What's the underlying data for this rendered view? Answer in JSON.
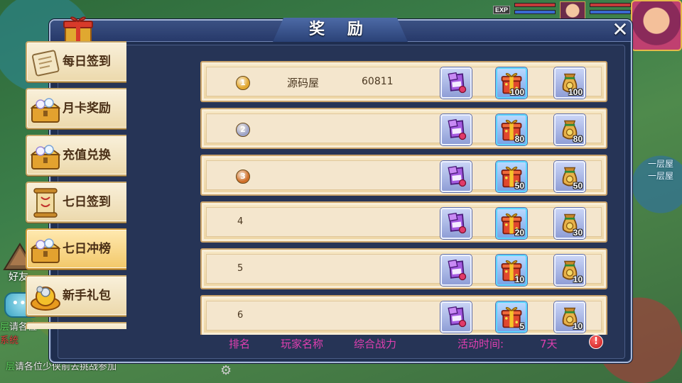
{
  "dialog": {
    "title": "奖  励",
    "close_symbol": "✕"
  },
  "hud": {
    "exp_label": "EXP"
  },
  "background": {
    "right_text": "一层屋\n一层屋",
    "friend_label": "好友",
    "chat_lines": [
      {
        "tag": "层",
        "text": "请各位"
      },
      {
        "tag": "系统",
        "text": ""
      }
    ],
    "bottom_chat": {
      "tag": "层",
      "text": "请各位少侠前去挑战参加"
    }
  },
  "nav": {
    "items": [
      {
        "label": "每日签到",
        "icon": "paper-scroll-icon",
        "active": false
      },
      {
        "label": "月卡奖励",
        "icon": "treasure-chest-icon",
        "active": false
      },
      {
        "label": "充值兑换",
        "icon": "treasure-chest-icon",
        "active": false
      },
      {
        "label": "七日签到",
        "icon": "scroll-icon",
        "active": false
      },
      {
        "label": "七日冲榜",
        "icon": "treasure-chest-icon",
        "active": true
      },
      {
        "label": "新手礼包",
        "icon": "gold-ingot-icon",
        "active": false
      }
    ]
  },
  "rows": [
    {
      "rank": "1",
      "medal": "gold",
      "name": "源码屋",
      "power": "60811",
      "rewards": [
        {
          "icon": "purple-scroll-icon",
          "qty": ""
        },
        {
          "icon": "gift-box-icon",
          "qty": "100"
        },
        {
          "icon": "money-bag-icon",
          "qty": "100"
        }
      ]
    },
    {
      "rank": "2",
      "medal": "silver",
      "name": "",
      "power": "",
      "rewards": [
        {
          "icon": "purple-scroll-icon",
          "qty": ""
        },
        {
          "icon": "gift-box-icon",
          "qty": "80"
        },
        {
          "icon": "money-bag-icon",
          "qty": "80"
        }
      ]
    },
    {
      "rank": "3",
      "medal": "bronze",
      "name": "",
      "power": "",
      "rewards": [
        {
          "icon": "purple-scroll-icon",
          "qty": ""
        },
        {
          "icon": "gift-box-icon",
          "qty": "50"
        },
        {
          "icon": "money-bag-icon",
          "qty": "50"
        }
      ]
    },
    {
      "rank": "4",
      "medal": "",
      "name": "",
      "power": "",
      "rewards": [
        {
          "icon": "purple-scroll-icon",
          "qty": ""
        },
        {
          "icon": "gift-box-icon",
          "qty": "20"
        },
        {
          "icon": "money-bag-icon",
          "qty": "30"
        }
      ]
    },
    {
      "rank": "5",
      "medal": "",
      "name": "",
      "power": "",
      "rewards": [
        {
          "icon": "purple-scroll-icon",
          "qty": ""
        },
        {
          "icon": "gift-box-icon",
          "qty": "10"
        },
        {
          "icon": "money-bag-icon",
          "qty": "10"
        }
      ]
    },
    {
      "rank": "6",
      "medal": "",
      "name": "",
      "power": "",
      "rewards": [
        {
          "icon": "purple-scroll-icon",
          "qty": ""
        },
        {
          "icon": "gift-box-icon",
          "qty": "5"
        },
        {
          "icon": "money-bag-icon",
          "qty": "10"
        }
      ]
    }
  ],
  "footer": {
    "rank_label": "排名",
    "player_name_label": "玩家名称",
    "power_label": "综合战力",
    "time_label": "活动时间:",
    "time_value": "7天",
    "warn_symbol": "!"
  },
  "colors": {
    "footer_text": "#e03fb0",
    "dialog_bg": "#1f2e4f",
    "row_bg": "#f4e6cd",
    "gold_medal": "#e2a72e",
    "silver_medal": "#9ea4c8",
    "bronze_medal": "#d0702a"
  }
}
